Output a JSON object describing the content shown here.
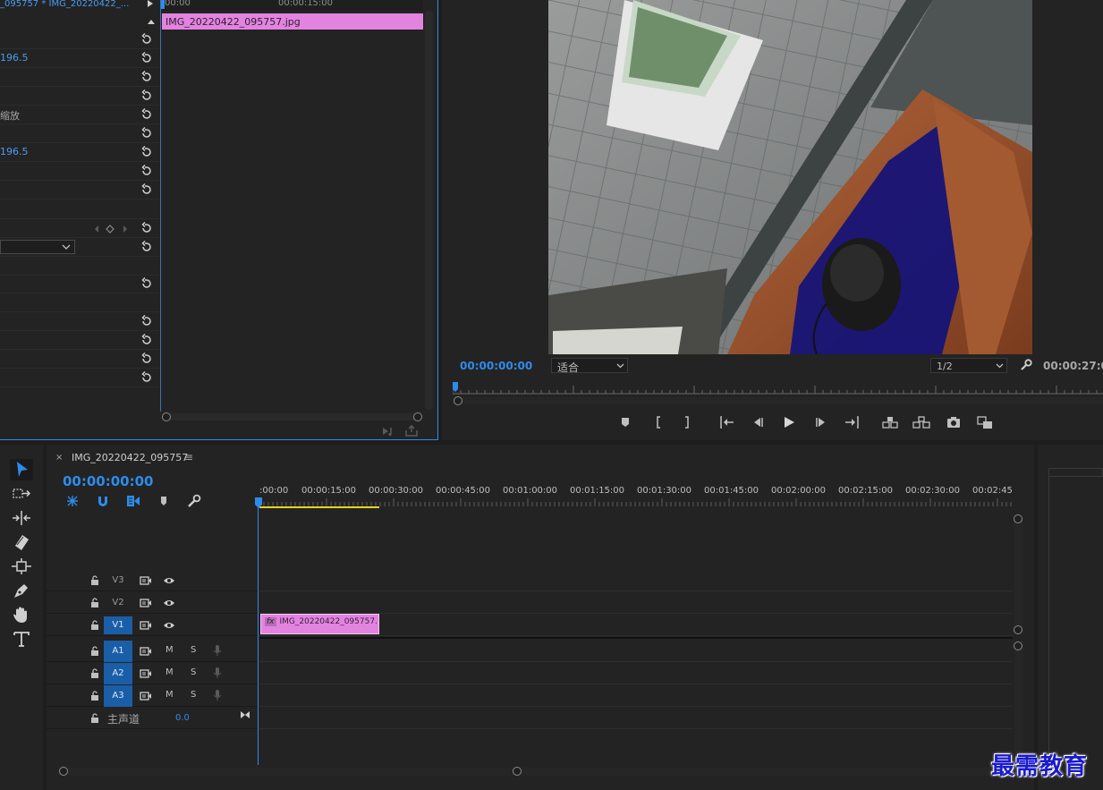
{
  "effect_controls": {
    "header": "_095757 * IMG_20220422_...",
    "rows": [
      {
        "text": "",
        "kind": "blank"
      },
      {
        "text": "196.5",
        "kind": "value"
      },
      {
        "text": "",
        "kind": "blank"
      },
      {
        "text": "",
        "kind": "blank"
      },
      {
        "text": "缩放",
        "kind": "text"
      },
      {
        "text": "",
        "kind": "blank"
      },
      {
        "text": "196.5",
        "kind": "value"
      },
      {
        "text": "",
        "kind": "blank"
      },
      {
        "text": "",
        "kind": "blank"
      }
    ],
    "ruler_start": "00:00",
    "ruler_mid": "00:00:15:00",
    "clip_name": "IMG_20220422_095757.jpg"
  },
  "program_monitor": {
    "timecode_current": "00:00:00:00",
    "fit_label": "适合",
    "resolution_label": "1/2",
    "timecode_duration": "00:00:27:0",
    "colors": {
      "accent": "#2d8ceb",
      "clip": "#e383e0"
    }
  },
  "timeline": {
    "tab_close": "×",
    "sequence_name": "IMG_20220422_095757",
    "tab_menu": "≡",
    "timecode": "00:00:00:00",
    "ruler_labels": [
      ":00:00",
      "00:00:15:00",
      "00:00:30:00",
      "00:00:45:00",
      "00:01:00:00",
      "00:01:15:00",
      "00:01:30:00",
      "00:01:45:00",
      "00:02:00:00",
      "00:02:15:00",
      "00:02:30:00",
      "00:02:45:"
    ],
    "video_tracks": [
      "V3",
      "V2",
      "V1"
    ],
    "audio_tracks": [
      "A1",
      "A2",
      "A3"
    ],
    "mute_label": "M",
    "solo_label": "S",
    "master_label": "主声道",
    "master_value": "0.0",
    "clip": {
      "fx": "fx",
      "name": "IMG_20220422_095757."
    }
  },
  "watermark": "最需教育"
}
